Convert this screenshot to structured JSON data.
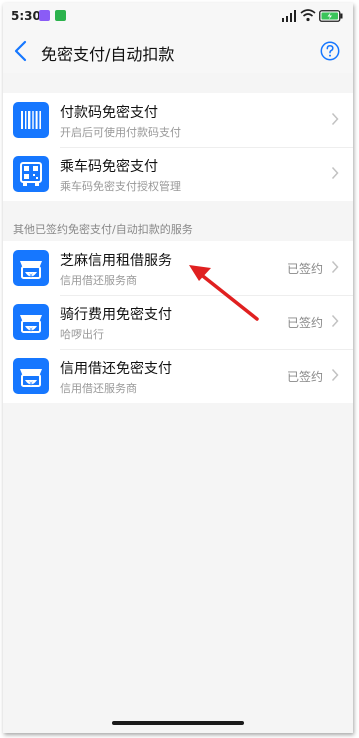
{
  "status_bar": {
    "time": "5:30"
  },
  "header": {
    "title": "免密支付/自动扣款"
  },
  "primary_items": [
    {
      "title": "付款码免密支付",
      "subtitle": "开启后可使用付款码支付",
      "icon": "barcode-icon"
    },
    {
      "title": "乘车码免密支付",
      "subtitle": "乘车码免密支付授权管理",
      "icon": "bus-qr-icon"
    }
  ],
  "services_section": {
    "heading": "其他已签约免密支付/自动扣款的服务",
    "items": [
      {
        "title": "芝麻信用租借服务",
        "subtitle": "信用借还服务商",
        "status": "已签约",
        "icon": "shop-icon"
      },
      {
        "title": "骑行费用免密支付",
        "subtitle": "哈啰出行",
        "status": "已签约",
        "icon": "shop-icon"
      },
      {
        "title": "信用借还免密支付",
        "subtitle": "信用借还服务商",
        "status": "已签约",
        "icon": "shop-icon"
      }
    ]
  },
  "colors": {
    "accent": "#1677ff",
    "annotation_arrow": "#e02020",
    "background": "#f5f5f5"
  }
}
